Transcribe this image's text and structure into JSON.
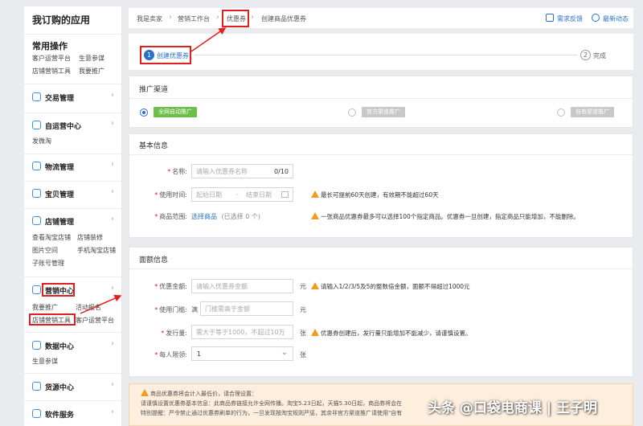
{
  "sidebar": {
    "title": "我订购的应用",
    "common": {
      "title": "常用操作",
      "links": [
        "客户运营平台",
        "生意参谋",
        "店铺营销工具",
        "我要推广"
      ]
    },
    "sections": {
      "trade": {
        "label": "交易管理"
      },
      "self_ops": {
        "label": "自运营中心",
        "links": [
          "发微淘"
        ]
      },
      "logistics": {
        "label": "物流管理"
      },
      "goods": {
        "label": "宝贝管理"
      },
      "shop": {
        "label": "店铺管理",
        "links": [
          "查看淘宝店铺",
          "店铺装修",
          "图片空间",
          "手机淘宝店铺",
          "子账号管理"
        ]
      },
      "marketing": {
        "label": "营销中心",
        "links": [
          "我要推广",
          "活动报名",
          "店铺营销工具",
          "客户运营平台"
        ]
      },
      "data": {
        "label": "数据中心",
        "links": [
          "生意参谋"
        ]
      },
      "supply": {
        "label": "货源中心"
      },
      "software": {
        "label": "软件服务"
      }
    }
  },
  "breadcrumb": [
    "我是卖家",
    "营销工作台",
    "优惠券",
    "创建商品优惠券"
  ],
  "header_links": {
    "feedback": "需求反馈",
    "news": "最新动态"
  },
  "steps": [
    {
      "num": "1",
      "label": "创建优惠券"
    },
    {
      "num": "2",
      "label": "完成"
    }
  ],
  "channel": {
    "title": "推广渠道",
    "options": [
      {
        "label": "全网自动推广",
        "selected": true
      },
      {
        "label": "官方渠道推广",
        "selected": false
      },
      {
        "label": "自有渠道推广",
        "selected": false
      }
    ]
  },
  "basic": {
    "title": "基本信息",
    "name_label": "名称:",
    "name_placeholder": "请输入优惠券名称",
    "name_counter": "0/10",
    "time_label": "使用时间:",
    "start_placeholder": "起始日期",
    "dash": "-",
    "end_placeholder": "结束日期",
    "time_hint": "最长可提前60天创建，有效期不能超过60天",
    "range_label": "商品范围:",
    "range_link": "选择商品",
    "range_count": "(已选择 0 个)",
    "range_hint": "一张商品优惠券最多可以选择100个指定商品。优惠券一旦创建，指定商品只能增加，不能删除。"
  },
  "amount": {
    "title": "面额信息",
    "value_label": "优惠金额:",
    "value_placeholder": "请输入优惠券金额",
    "unit_yuan": "元",
    "value_hint": "请输入1/2/3/5及5的整数倍金额，面额不得超过1000元",
    "threshold_label": "使用门槛:",
    "threshold_prefix": "满",
    "threshold_placeholder": "门槛需高于金额",
    "issue_label": "发行量:",
    "issue_placeholder": "需大于等于1000，不超过10万",
    "unit_zhang": "张",
    "issue_hint": "优惠券创建后，发行量只能增加不能减少，请谨慎设置。",
    "limit_label": "每人限领:",
    "limit_value": "1"
  },
  "notice": {
    "line1": "商品优惠券将会计入最低价，请合理设置：",
    "line2": "请谨慎设置优惠券基本信息：此商品券链接允许全网传播。淘宝5.23日起，天猫5.30日起，商品券将会在",
    "line3": "特别提醒：严令禁止通过优惠券刷单的行为，一旦发现按淘宝规则严惩，其余非官方渠道推广请使用\"自有"
  },
  "watermark": "头条 @口袋电商课 | 王子明",
  "colors": {
    "accent": "#2a6fc9",
    "highlight": "#e02020",
    "green": "#6cc04a",
    "warn": "#f29c1f"
  }
}
